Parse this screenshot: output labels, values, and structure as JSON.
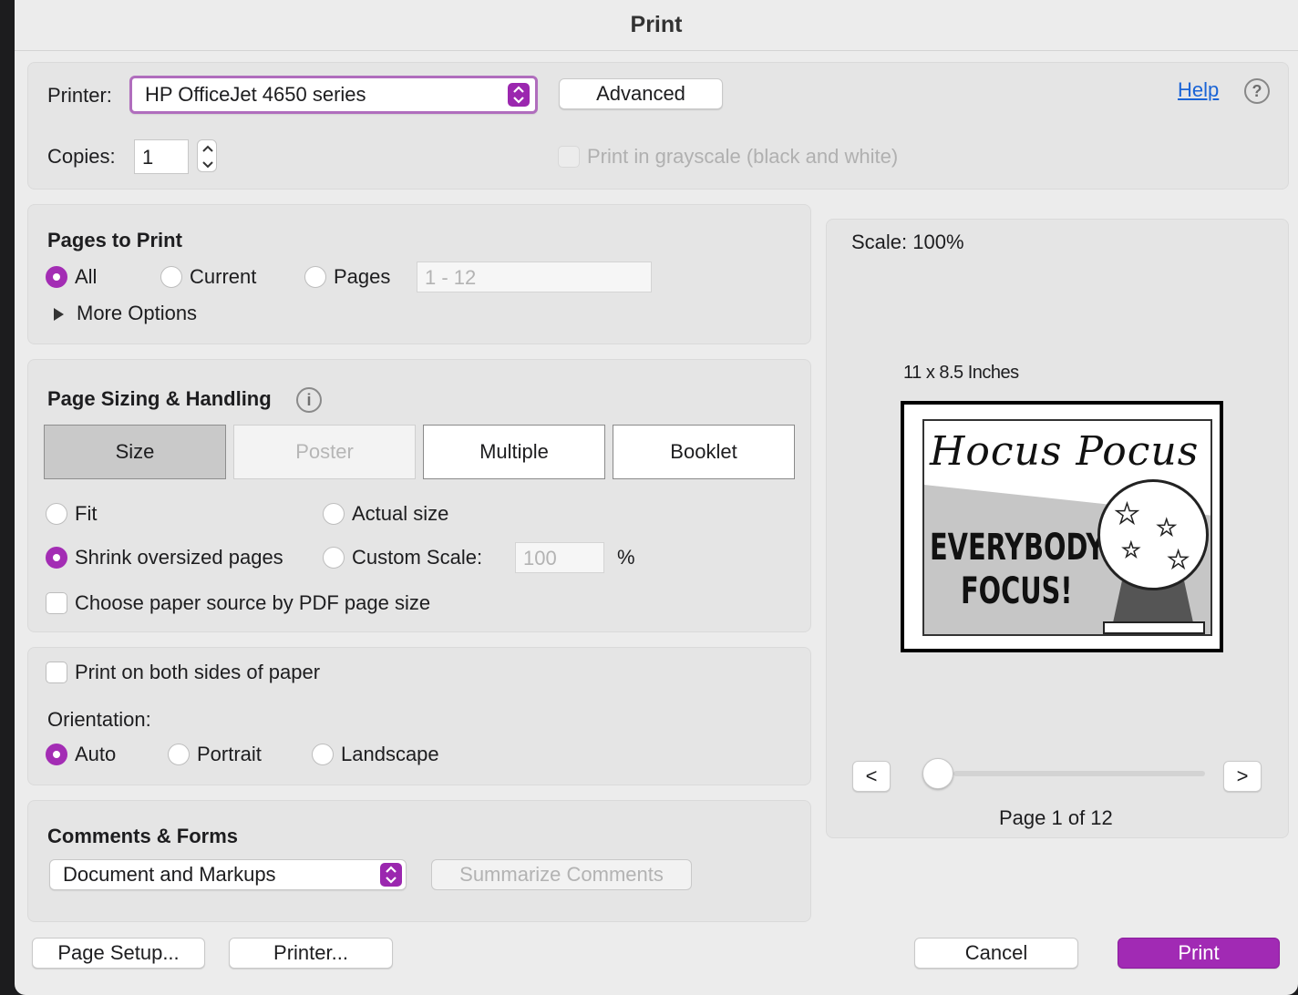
{
  "window": {
    "title": "Print"
  },
  "printer": {
    "label": "Printer:",
    "selected": "HP OfficeJet 4650 series",
    "advanced_label": "Advanced",
    "help_label": "Help",
    "help_icon": "?"
  },
  "copies": {
    "label": "Copies:",
    "value": "1"
  },
  "grayscale": {
    "label": "Print in grayscale (black and white)",
    "checked": false,
    "enabled": false
  },
  "pages_to_print": {
    "heading": "Pages to Print",
    "options": [
      "All",
      "Current",
      "Pages"
    ],
    "selected": "All",
    "range_placeholder": "1 - 12",
    "more_options_label": "More Options"
  },
  "sizing": {
    "heading": "Page Sizing & Handling",
    "info_icon": "i",
    "tabs": [
      "Size",
      "Poster",
      "Multiple",
      "Booklet"
    ],
    "active_tab": "Size",
    "disabled_tab": "Poster",
    "fit_label": "Fit",
    "actual_size_label": "Actual size",
    "shrink_label": "Shrink oversized pages",
    "custom_scale_label": "Custom Scale:",
    "custom_scale_value": "100",
    "percent_sign": "%",
    "selected": "Shrink oversized pages",
    "paper_source_label": "Choose paper source by PDF page size"
  },
  "duplex": {
    "both_sides_label": "Print on both sides of paper",
    "orientation_label": "Orientation:",
    "orientations": [
      "Auto",
      "Portrait",
      "Landscape"
    ],
    "selected": "Auto"
  },
  "comments": {
    "heading": "Comments & Forms",
    "selected": "Document and Markups",
    "summarize_label": "Summarize Comments"
  },
  "preview": {
    "scale_label": "Scale: 100%",
    "paper_size": "11 x 8.5 Inches",
    "page_title_art": "Hocus Pocus",
    "page_line1": "EVERYBODY",
    "page_line2": "FOCUS!",
    "prev_label": "<",
    "next_label": ">",
    "page_indicator": "Page 1 of 12",
    "page_position_fraction": 0.0
  },
  "footer": {
    "page_setup_label": "Page Setup...",
    "printer_label": "Printer...",
    "cancel_label": "Cancel",
    "print_label": "Print"
  },
  "colors": {
    "accent": "#a32db4",
    "print_button": "#a12ab4",
    "link": "#1a64d6"
  },
  "icons": {
    "popup_arrows": "updown-chevron-icon",
    "disclosure": "triangle-right-icon"
  }
}
